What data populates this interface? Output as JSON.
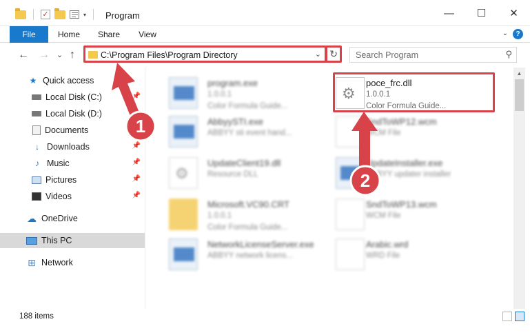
{
  "window": {
    "title": "Program",
    "minimize_glyph": "—",
    "maximize_glyph": "☐",
    "close_glyph": "✕"
  },
  "quick_access_toolbar": {
    "dropdown_glyph": "▾"
  },
  "ribbon": {
    "tabs": [
      {
        "label": "File"
      },
      {
        "label": "Home"
      },
      {
        "label": "Share"
      },
      {
        "label": "View"
      }
    ],
    "expand_glyph": "⌄",
    "help_glyph": "?"
  },
  "navigation": {
    "back_glyph": "←",
    "forward_glyph": "→",
    "recent_glyph": "⌄",
    "up_glyph": "↑"
  },
  "address_bar": {
    "path": "C:\\Program Files\\Program Directory",
    "dropdown_glyph": "⌄",
    "refresh_glyph": "↻"
  },
  "search": {
    "placeholder": "Search Program",
    "icon": "search-icon",
    "glyph": "⚲"
  },
  "sidebar": {
    "items": [
      {
        "label": "Quick access",
        "icon": "star-icon",
        "glyph": "★"
      },
      {
        "label": "Local Disk (C:)",
        "icon": "disk-icon",
        "pinned": true
      },
      {
        "label": "Local Disk (D:)",
        "icon": "disk-icon"
      },
      {
        "label": "Documents",
        "icon": "document-icon",
        "pinned": true
      },
      {
        "label": "Downloads",
        "icon": "download-icon",
        "glyph": "↓",
        "pinned": true
      },
      {
        "label": "Music",
        "icon": "music-icon",
        "glyph": "♪",
        "pinned": true
      },
      {
        "label": "Pictures",
        "icon": "pictures-icon",
        "pinned": true
      },
      {
        "label": "Videos",
        "icon": "videos-icon",
        "pinned": true
      },
      {
        "label": "OneDrive",
        "icon": "cloud-icon",
        "glyph": "☁"
      },
      {
        "label": "This PC",
        "icon": "computer-icon",
        "selected": true
      },
      {
        "label": "Network",
        "icon": "network-icon",
        "glyph": "⊞"
      }
    ],
    "pin_glyph": "📌"
  },
  "files": {
    "left_column": [
      {
        "name": "program.exe",
        "line2": "1.0.0.1",
        "line3": "Color Formula Guide...",
        "icon": "exe-icon"
      },
      {
        "name": "AbbyySTI.exe",
        "line2": "ABBYY sti event hand...",
        "line3": "",
        "icon": "exe-icon"
      },
      {
        "name": "UpdateClient19.dll",
        "line2": "Resource DLL",
        "line3": "",
        "icon": "dll-icon"
      },
      {
        "name": "Microsoft.VC90.CRT",
        "line2": "1.0.0.1",
        "line3": "Color Formula Guide...",
        "icon": "folder-icon"
      },
      {
        "name": "NetworkLicenseServer.exe",
        "line2": "ABBYY network licens...",
        "line3": "",
        "icon": "exe-icon"
      }
    ],
    "right_column": [
      {
        "name": "poce_frc.dll",
        "line2": "1.0.0.1",
        "line3": "Color Formula Guide...",
        "icon": "dll-gear-icon",
        "highlighted": true
      },
      {
        "name": "SndToWP12.wcm",
        "line2": "WCM File",
        "line3": "",
        "icon": "file-icon"
      },
      {
        "name": "UpdateInstaller.exe",
        "line2": "ABBYY updater installer",
        "line3": "",
        "icon": "exe-icon"
      },
      {
        "name": "SndToWP13.wcm",
        "line2": "WCM File",
        "line3": "",
        "icon": "file-icon"
      },
      {
        "name": "Arabic.wrd",
        "line2": "WRD File",
        "line3": "",
        "icon": "file-icon"
      }
    ]
  },
  "status_bar": {
    "item_count": "188 items"
  },
  "annotations": {
    "step1_label": "1",
    "step2_label": "2",
    "highlight_color": "#d8434a",
    "badge_color": "#d8434a"
  },
  "colors": {
    "accent": "#1979ca",
    "selection": "#d9d9d9"
  }
}
